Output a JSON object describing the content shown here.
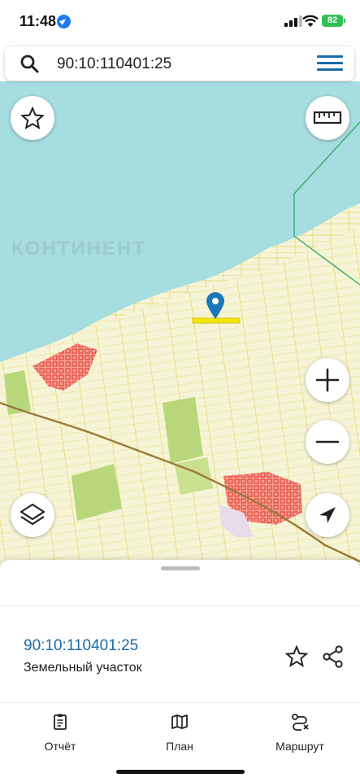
{
  "status_bar": {
    "time": "11:48",
    "battery": "82"
  },
  "search": {
    "value": "90:10:110401:25"
  },
  "map": {
    "watermark": "КОНТИНЕНТ",
    "icons": [
      "star-icon",
      "ruler-icon",
      "zoom-in-icon",
      "zoom-out-icon",
      "layers-icon",
      "location-arrow-icon",
      "map-pin-icon"
    ]
  },
  "card": {
    "parcel_id": "90:10:110401:25",
    "parcel_type": "Земельный участок"
  },
  "tabs": [
    {
      "label": "Отчёт",
      "icon": "clipboard-icon"
    },
    {
      "label": "План",
      "icon": "map-icon"
    },
    {
      "label": "Маршрут",
      "icon": "route-icon"
    }
  ],
  "colors": {
    "accent": "#1a6ca8",
    "sea": "#a6dde0",
    "land": "#f6f4d6",
    "battery": "#31c152"
  }
}
